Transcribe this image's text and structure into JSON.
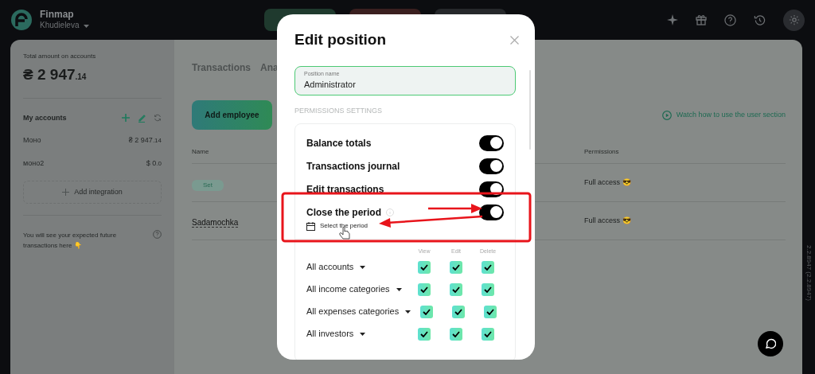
{
  "header": {
    "brand": "Finmap",
    "account": "Khudieleva",
    "action_buttons": [
      {
        "color": "#1f3a2e"
      },
      {
        "color": "#3a1f1f"
      },
      {
        "color": "#26282b"
      }
    ]
  },
  "sidebar": {
    "total_label": "Total amount on accounts",
    "currency": "₴",
    "amount": "2 947",
    "fraction": ".14",
    "accounts_title": "My accounts",
    "accounts": [
      {
        "name": "Моно",
        "currency": "₴",
        "amount": "2 947",
        "fraction": ".14"
      },
      {
        "name": "моно2",
        "currency": "$",
        "amount": "0",
        "fraction": ".0"
      }
    ],
    "add_integration": "Add integration",
    "future_note": "You will see your expected future transactions here 👇"
  },
  "main": {
    "tabs": [
      {
        "label": "Transactions",
        "selected": false
      },
      {
        "label": "Ana",
        "selected": false
      }
    ],
    "add_button": "Add employee",
    "watch_link": "Watch how to use the user section",
    "table": {
      "columns": [
        "Name",
        "Permissions"
      ],
      "rows": [
        {
          "name": "Set",
          "kind": "badge",
          "permissions": "Full access 😎"
        },
        {
          "name": "Sadamochka",
          "kind": "text",
          "permissions": "Full access 😎"
        }
      ]
    }
  },
  "modal": {
    "title": "Edit position",
    "field": {
      "label": "Position name",
      "value": "Administrator"
    },
    "section": "PERMISSIONS SETTINGS",
    "toggles": [
      {
        "label": "Balance totals",
        "on": true
      },
      {
        "label": "Transactions journal",
        "on": true
      },
      {
        "label": "Edit transactions",
        "on": true
      },
      {
        "label": "Close the period",
        "on": true,
        "info": true,
        "link": "Select the period"
      }
    ],
    "columns": [
      "View",
      "Edit",
      "Delete"
    ],
    "rows": [
      {
        "label": "All accounts",
        "checked": [
          true,
          true,
          true
        ]
      },
      {
        "label": "All income categories",
        "checked": [
          true,
          true,
          true
        ]
      },
      {
        "label": "All expenses categories",
        "checked": [
          true,
          true,
          true
        ]
      },
      {
        "label": "All investors",
        "checked": [
          true,
          true,
          true
        ]
      }
    ]
  },
  "version": "2.2.8947 (2.2.8947)"
}
